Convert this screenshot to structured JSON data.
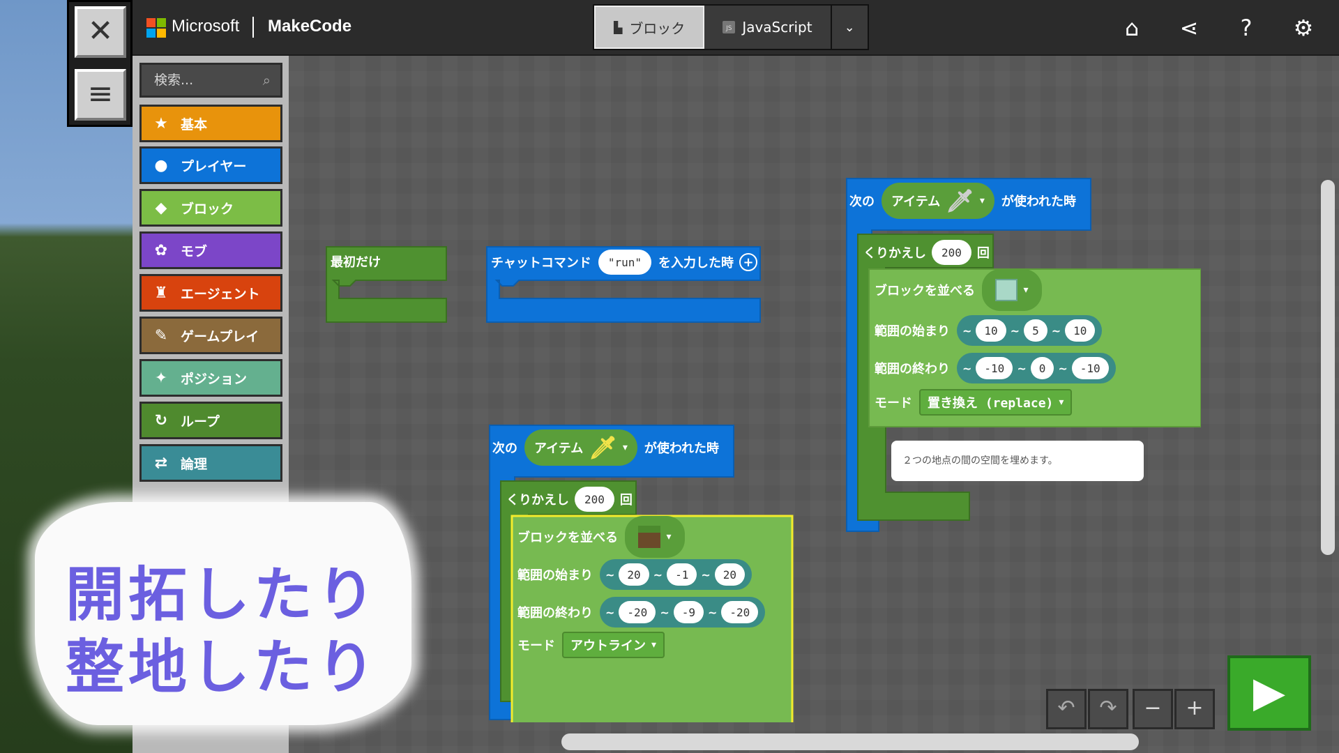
{
  "header": {
    "brand_ms": "Microsoft",
    "brand_app": "MakeCode",
    "tab_blocks": "ブロック",
    "tab_js": "JavaScript",
    "icons": [
      "home-icon",
      "share-icon",
      "help-icon",
      "settings-icon"
    ]
  },
  "toolbox": {
    "search_placeholder": "検索...",
    "categories": [
      {
        "label": "基本",
        "icon": "★",
        "color": "#e8930c"
      },
      {
        "label": "プレイヤー",
        "icon": "●",
        "color": "#0d73d8"
      },
      {
        "label": "ブロック",
        "icon": "◆",
        "color": "#7cbd46"
      },
      {
        "label": "モブ",
        "icon": "✿",
        "color": "#7c46c8"
      },
      {
        "label": "エージェント",
        "icon": "♜",
        "color": "#d8430e"
      },
      {
        "label": "ゲームプレイ",
        "icon": "✎",
        "color": "#8b6a3c"
      },
      {
        "label": "ポジション",
        "icon": "✦",
        "color": "#64b08f"
      },
      {
        "label": "ループ",
        "icon": "↻",
        "color": "#4f8a2e"
      },
      {
        "label": "論理",
        "icon": "⇄",
        "color": "#3a8c96"
      }
    ]
  },
  "blocks": {
    "on_start": "最初だけ",
    "chat_prefix": "チャットコマンド",
    "chat_value": "\"run\"",
    "chat_suffix": "を入力した時",
    "when_prefix": "次の",
    "when_item": "アイテム",
    "when_suffix": "が使われた時",
    "repeat": "くりかえし",
    "repeat_suffix": "回",
    "fill": "ブロックを並べる",
    "from": "範囲の始まり",
    "to": "範囲の終わり",
    "mode": "モード",
    "tilde": "~",
    "top_block": {
      "repeat_count": "200",
      "from": [
        "10",
        "5",
        "10"
      ],
      "to": [
        "-10",
        "0",
        "-10"
      ],
      "mode_value": "置き換え (replace)"
    },
    "bottom_block": {
      "repeat_count": "200",
      "from": [
        "20",
        "-1",
        "20"
      ],
      "to": [
        "-20",
        "-9",
        "-20"
      ],
      "mode_value": "アウトライン"
    }
  },
  "tooltip": "２つの地点の間の空間を埋めます。",
  "caption": {
    "line1": "開拓したり",
    "line2": "整地したり"
  }
}
